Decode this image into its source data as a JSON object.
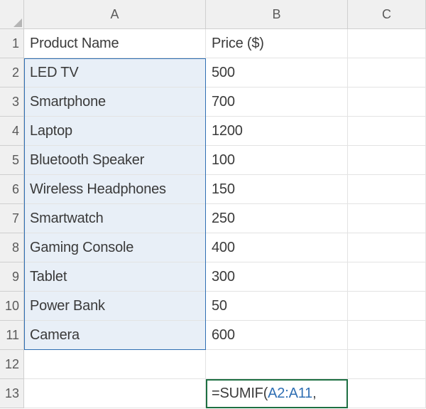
{
  "columns": [
    "A",
    "B",
    "C"
  ],
  "row_numbers": [
    "1",
    "2",
    "3",
    "4",
    "5",
    "6",
    "7",
    "8",
    "9",
    "10",
    "11",
    "12",
    "13"
  ],
  "header_row": {
    "A": "Product Name",
    "B": "Price ($)"
  },
  "data_rows": [
    {
      "A": "LED TV",
      "B": "500"
    },
    {
      "A": "Smartphone",
      "B": "700"
    },
    {
      "A": "Laptop",
      "B": "1200"
    },
    {
      "A": "Bluetooth Speaker",
      "B": "100"
    },
    {
      "A": "Wireless Headphones",
      "B": "150"
    },
    {
      "A": "Smartwatch",
      "B": "250"
    },
    {
      "A": "Gaming Console",
      "B": "400"
    },
    {
      "A": "Tablet",
      "B": "300"
    },
    {
      "A": "Power Bank",
      "B": "50"
    },
    {
      "A": "Camera",
      "B": "600"
    }
  ],
  "formula": {
    "prefix": "=SUMIF(",
    "ref": "A2:A11",
    "suffix": ","
  },
  "chart_data": {
    "type": "table",
    "columns": [
      "Product Name",
      "Price ($)"
    ],
    "rows": [
      [
        "LED TV",
        500
      ],
      [
        "Smartphone",
        700
      ],
      [
        "Laptop",
        1200
      ],
      [
        "Bluetooth Speaker",
        100
      ],
      [
        "Wireless Headphones",
        150
      ],
      [
        "Smartwatch",
        250
      ],
      [
        "Gaming Console",
        400
      ],
      [
        "Tablet",
        300
      ],
      [
        "Power Bank",
        50
      ],
      [
        "Camera",
        600
      ]
    ]
  }
}
